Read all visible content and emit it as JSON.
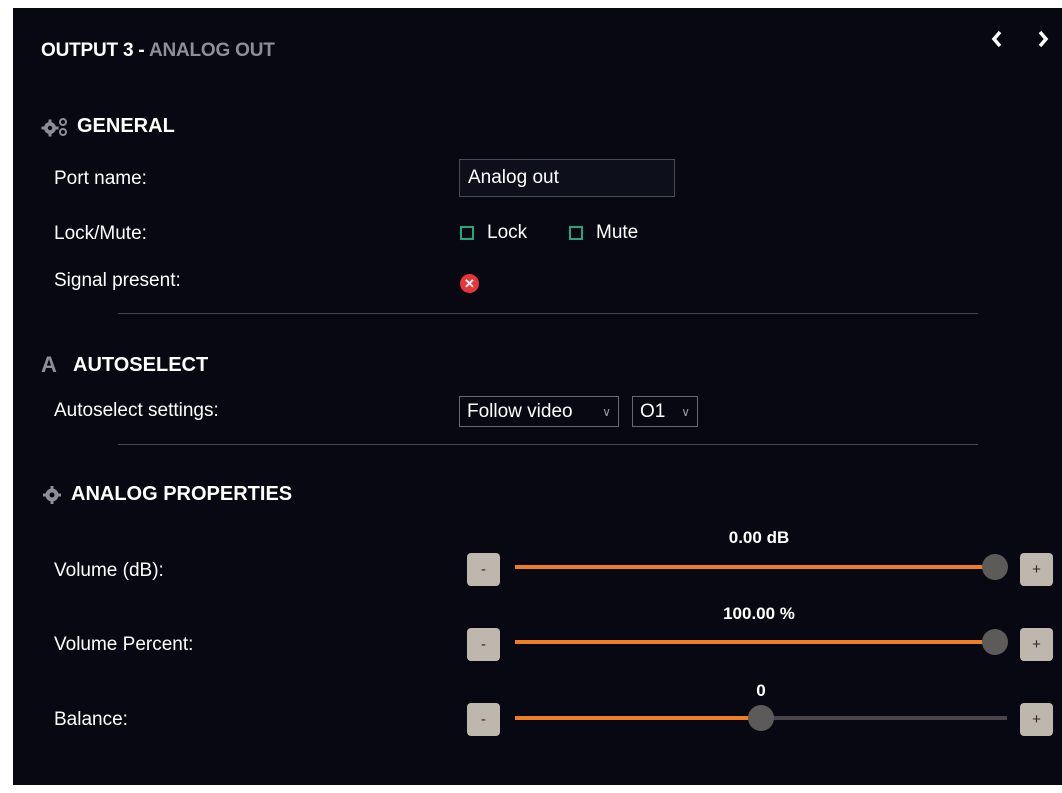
{
  "header": {
    "title": "OUTPUT 3 - ",
    "subtitle": "ANALOG OUT",
    "prev_icon": "chevron-left-icon",
    "next_icon": "chevron-right-icon"
  },
  "general": {
    "title": "GENERAL",
    "icon": "gears-icon",
    "port_name_label": "Port name:",
    "port_name_value": "Analog out",
    "lock_mute_label": "Lock/Mute:",
    "lock_label": "Lock",
    "lock_checked": false,
    "mute_label": "Mute",
    "mute_checked": false,
    "signal_present_label": "Signal present:",
    "signal_present_icon": "error-x-icon",
    "signal_present_color": "#e8353c"
  },
  "autoselect": {
    "title": "AUTOSELECT",
    "icon": "letter-a-icon",
    "settings_label": "Autoselect settings:",
    "mode_value": "Follow video",
    "source_value": "O1"
  },
  "analog_properties": {
    "title": "ANALOG PROPERTIES",
    "icon": "gear-icon",
    "sliders": [
      {
        "label": "Volume (dB):",
        "value_text": "0.00 dB",
        "fraction": 0.975,
        "minus": "-",
        "plus": "+"
      },
      {
        "label": "Volume Percent:",
        "value_text": "100.00 %",
        "fraction": 0.975,
        "minus": "-",
        "plus": "+"
      },
      {
        "label": "Balance:",
        "value_text": "0",
        "fraction": 0.5,
        "minus": "-",
        "plus": "+"
      }
    ]
  },
  "colors": {
    "background": "#070811",
    "accent_orange": "#f07d22",
    "checkbox_green": "#25a77b",
    "muted_gray": "#8d8f96"
  }
}
